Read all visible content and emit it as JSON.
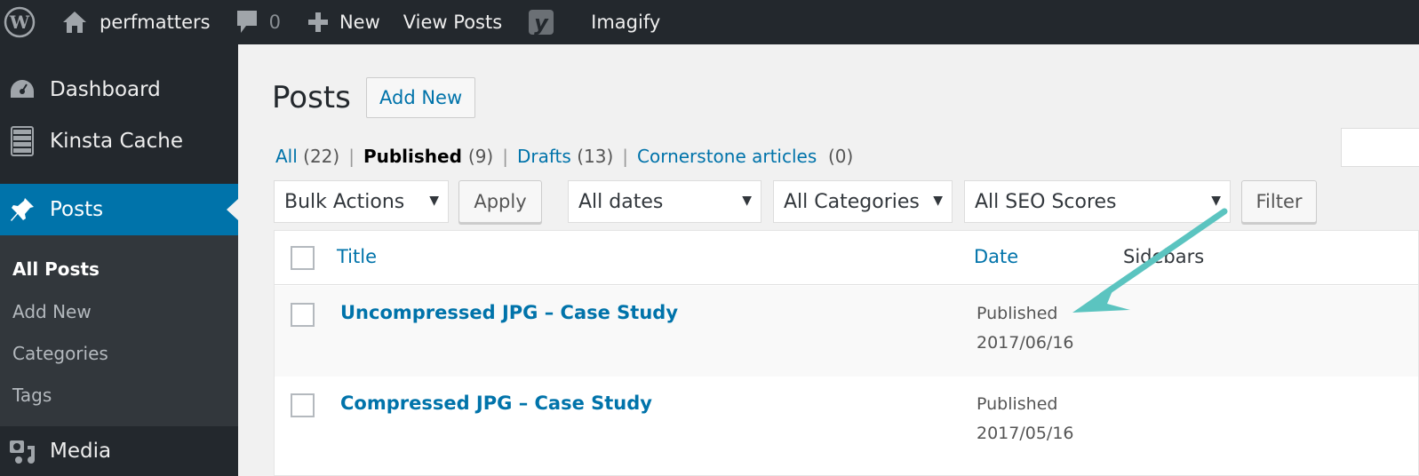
{
  "admin_bar": {
    "site_name": "perfmatters",
    "comments_count": "0",
    "new_label": "New",
    "view_posts_label": "View Posts",
    "imagify_label": "Imagify"
  },
  "sidebar": {
    "items": [
      {
        "label": "Dashboard",
        "icon": "dashboard-icon"
      },
      {
        "label": "Kinsta Cache",
        "icon": "server-icon"
      },
      {
        "label": "Posts",
        "icon": "pin-icon",
        "active": true
      },
      {
        "label": "Media",
        "icon": "media-icon"
      }
    ],
    "posts_submenu": [
      {
        "label": "All Posts",
        "current": true
      },
      {
        "label": "Add New"
      },
      {
        "label": "Categories"
      },
      {
        "label": "Tags"
      }
    ]
  },
  "page": {
    "title": "Posts",
    "add_new_label": "Add New"
  },
  "views": {
    "all": {
      "label": "All",
      "count": "(22)"
    },
    "published": {
      "label": "Published",
      "count": "(9)"
    },
    "drafts": {
      "label": "Drafts",
      "count": "(13)"
    },
    "cornerstone": {
      "label": "Cornerstone articles",
      "count": "(0)"
    },
    "separator": "|"
  },
  "filters": {
    "bulk_actions": "Bulk Actions",
    "apply_label": "Apply",
    "dates": "All dates",
    "categories": "All Categories",
    "seo_scores": "All SEO Scores",
    "filter_label": "Filter",
    "caret": "▼"
  },
  "table": {
    "columns": {
      "title": "Title",
      "date": "Date",
      "sidebars": "Sidebars"
    },
    "rows": [
      {
        "title": "Uncompressed JPG – Case Study",
        "status": "Published",
        "date": "2017/06/16"
      },
      {
        "title": "Compressed JPG – Case Study",
        "status": "Published",
        "date": "2017/05/16"
      }
    ]
  },
  "annotation": {
    "arrow_color": "#5bc4c0"
  }
}
